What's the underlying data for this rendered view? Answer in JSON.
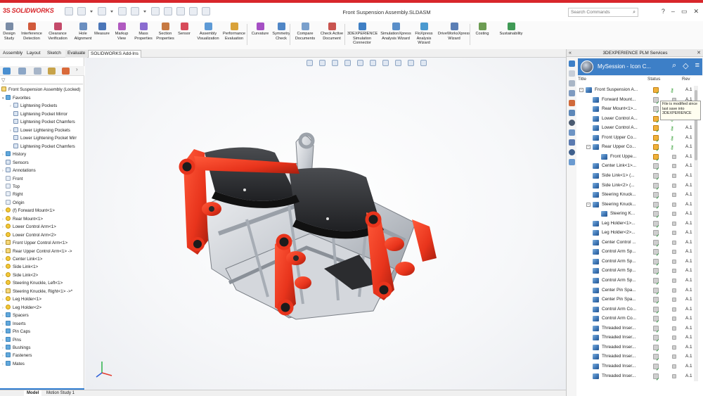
{
  "app": {
    "logo_text": "SOLIDWORKS",
    "logo_prefix": "3S",
    "document_title": "Front Suspension Assembly.SLDASM",
    "search_placeholder": "Search Commands",
    "accent_color": "#d8262b"
  },
  "ribbon": {
    "buttons": [
      {
        "label": "Design\nStudy",
        "icon": "design-study-icon",
        "color": "#7a8ca6"
      },
      {
        "label": "Interference\nDetection",
        "icon": "interference-icon",
        "color": "#d15a3c"
      },
      {
        "label": "Clearance\nVerification",
        "icon": "clearance-icon",
        "color": "#c44a6a"
      },
      {
        "label": "Hole\nAlignment",
        "icon": "hole-icon",
        "color": "#6b8fc0"
      },
      {
        "label": "Measure",
        "icon": "measure-icon",
        "color": "#4b76b8"
      },
      {
        "label": "Markup\nView",
        "icon": "markup-icon",
        "color": "#b05ac0"
      },
      {
        "label": "Mass\nProperties",
        "icon": "mass-icon",
        "color": "#8b6cd0"
      },
      {
        "label": "Section\nProperties",
        "icon": "section-icon",
        "color": "#c77a42"
      },
      {
        "label": "Sensor",
        "icon": "sensor-icon",
        "color": "#d74b5a"
      },
      {
        "label": "Assembly\nVisualization",
        "icon": "assembly-vis-icon",
        "color": "#5d9ad6"
      },
      {
        "label": "Performance\nEvaluation",
        "icon": "performance-icon",
        "color": "#d9a23a"
      },
      {
        "label": "Curvature",
        "icon": "curvature-icon",
        "color": "#a54fc4"
      },
      {
        "label": "Symmetry\nCheck",
        "icon": "symmetry-icon",
        "color": "#4f86c6"
      },
      {
        "label": "Compare\nDocuments",
        "icon": "compare-icon",
        "color": "#7aa0cc"
      },
      {
        "label": "Check Active\nDocument",
        "icon": "check-doc-icon",
        "color": "#c9544f"
      },
      {
        "label": "3DEXPERIENCE\nSimulation\nConnector",
        "icon": "sim-connector-icon",
        "color": "#3f7fc4"
      },
      {
        "label": "SimulationXpress\nAnalysis Wizard",
        "icon": "simxpress-icon",
        "color": "#5a8fc9"
      },
      {
        "label": "FloXpress\nAnalysis\nWizard",
        "icon": "floxpress-icon",
        "color": "#4b9ad0"
      },
      {
        "label": "DriveWorksXpress\nWizard",
        "icon": "driveworks-icon",
        "color": "#5b7fb5"
      },
      {
        "label": "Costing",
        "icon": "costing-icon",
        "color": "#6c9c52"
      },
      {
        "label": "Sustainability",
        "icon": "sustainability-icon",
        "color": "#3f9a55"
      }
    ]
  },
  "tabs": {
    "items": [
      "Assembly",
      "Layout",
      "Sketch",
      "Evaluate",
      "SOLIDWORKS Add-Ins"
    ],
    "active": "Evaluate"
  },
  "tree": {
    "root": "Front Suspension Assembly  (Locked)",
    "items": [
      {
        "label": "Favorites",
        "icon": "folder",
        "indent": 1,
        "toggle": "▾"
      },
      {
        "label": "Lightening Pockets",
        "icon": "feat",
        "indent": 2,
        "toggle": "›"
      },
      {
        "label": "Lightening Pocket Mirror",
        "icon": "feat",
        "indent": 2,
        "toggle": ""
      },
      {
        "label": "Lightening Pocket Chamfers",
        "icon": "feat",
        "indent": 2,
        "toggle": ""
      },
      {
        "label": "Lower Lightening Pockets",
        "icon": "feat",
        "indent": 2,
        "toggle": "›"
      },
      {
        "label": "Lower Lightening Pocket Mirr",
        "icon": "feat",
        "indent": 2,
        "toggle": ""
      },
      {
        "label": "Lightening Pocket Chamfers",
        "icon": "feat",
        "indent": 2,
        "toggle": ""
      },
      {
        "label": "History",
        "icon": "folder",
        "indent": 1,
        "toggle": "›"
      },
      {
        "label": "Sensors",
        "icon": "feat",
        "indent": 1,
        "toggle": ""
      },
      {
        "label": "Annotations",
        "icon": "feat",
        "indent": 1,
        "toggle": "›"
      },
      {
        "label": "Front",
        "icon": "plane",
        "indent": 1,
        "toggle": ""
      },
      {
        "label": "Top",
        "icon": "plane",
        "indent": 1,
        "toggle": ""
      },
      {
        "label": "Right",
        "icon": "plane",
        "indent": 1,
        "toggle": ""
      },
      {
        "label": "Origin",
        "icon": "plane",
        "indent": 1,
        "toggle": ""
      },
      {
        "label": "(f) Forward Mount<1>",
        "icon": "yellow",
        "indent": 1,
        "toggle": "›"
      },
      {
        "label": "Rear Mount<1>",
        "icon": "yellow",
        "indent": 1,
        "toggle": "›"
      },
      {
        "label": "Lower Control Arm<1>",
        "icon": "yellow",
        "indent": 1,
        "toggle": "›"
      },
      {
        "label": "Lower Control Arm<2>",
        "icon": "yellow",
        "indent": 1,
        "toggle": "›"
      },
      {
        "label": "Front Upper Control Arm<1>",
        "icon": "asm",
        "indent": 1,
        "toggle": "›"
      },
      {
        "label": "Rear Upper Control Arm<1> ->",
        "icon": "asm",
        "indent": 1,
        "toggle": "›"
      },
      {
        "label": "Center Link<1>",
        "icon": "yellow",
        "indent": 1,
        "toggle": "›"
      },
      {
        "label": "Side Link<1>",
        "icon": "yellow",
        "indent": 1,
        "toggle": "›"
      },
      {
        "label": "Side Link<2>",
        "icon": "yellow",
        "indent": 1,
        "toggle": "›"
      },
      {
        "label": "Steering Knuckle, Left<1>",
        "icon": "yellow",
        "indent": 1,
        "toggle": "›"
      },
      {
        "label": "Steering Knuckle, Right<1> ->*",
        "icon": "asm",
        "indent": 1,
        "toggle": "›"
      },
      {
        "label": "Leg Holder<1>",
        "icon": "yellow",
        "indent": 1,
        "toggle": "›"
      },
      {
        "label": "Leg Holder<2>",
        "icon": "yellow",
        "indent": 1,
        "toggle": "›"
      },
      {
        "label": "Spacers",
        "icon": "folder",
        "indent": 1,
        "toggle": "›"
      },
      {
        "label": "Inserts",
        "icon": "folder",
        "indent": 1,
        "toggle": "›"
      },
      {
        "label": "Pin Caps",
        "icon": "folder",
        "indent": 1,
        "toggle": "›"
      },
      {
        "label": "Pins",
        "icon": "folder",
        "indent": 1,
        "toggle": "›"
      },
      {
        "label": "Bushings",
        "icon": "folder",
        "indent": 1,
        "toggle": "›"
      },
      {
        "label": "Fasteners",
        "icon": "folder",
        "indent": 1,
        "toggle": "›"
      },
      {
        "label": "Mates",
        "icon": "folder",
        "indent": 1,
        "toggle": "›"
      }
    ]
  },
  "bottom_tabs": {
    "items": [
      "Model",
      "Motion Study 1"
    ],
    "active": "Model"
  },
  "plm": {
    "panel_title": "3DEXPERIENCE PLM Services",
    "session": "MySession - Icon C...",
    "col_title": "Title",
    "col_status": "Status",
    "col_rev": "Rev",
    "tooltip": "File is modified since last save into 3DEXPERIENCE",
    "rows": [
      {
        "title": "Front Suspension A...",
        "level": 0,
        "expand": "−",
        "status": "orange",
        "key": true,
        "rev": "A.1"
      },
      {
        "title": "Forward Mount...",
        "level": 1,
        "expand": "",
        "status": "gray",
        "key": false,
        "rev": "A.1"
      },
      {
        "title": "Rear Mount<1>...",
        "level": 1,
        "expand": "",
        "status": "gray",
        "key": false,
        "rev": "A.1"
      },
      {
        "title": "Lower Control A...",
        "level": 1,
        "expand": "",
        "status": "orange",
        "key": true,
        "rev": "A.1"
      },
      {
        "title": "Lower Control A...",
        "level": 1,
        "expand": "",
        "status": "orange",
        "key": true,
        "rev": "A.1"
      },
      {
        "title": "Front Upper Co...",
        "level": 1,
        "expand": "",
        "status": "orange",
        "key": true,
        "rev": "A.1"
      },
      {
        "title": "Rear Upper Co...",
        "level": 1,
        "expand": "−",
        "status": "orange",
        "key": true,
        "rev": "A.1"
      },
      {
        "title": "Front Uppe...",
        "level": 2,
        "expand": "",
        "status": "orange",
        "key": false,
        "rev": "A.1"
      },
      {
        "title": "Center Link<1>...",
        "level": 1,
        "expand": "",
        "status": "gray",
        "key": false,
        "rev": "A.1"
      },
      {
        "title": "Side Link<1> (...",
        "level": 1,
        "expand": "",
        "status": "gray",
        "key": false,
        "rev": "A.1"
      },
      {
        "title": "Side Link<2> (...",
        "level": 1,
        "expand": "",
        "status": "gray",
        "key": false,
        "rev": "A.1"
      },
      {
        "title": "Steering Knuck...",
        "level": 1,
        "expand": "",
        "status": "gray",
        "key": false,
        "rev": "A.1"
      },
      {
        "title": "Steering Knuck...",
        "level": 1,
        "expand": "−",
        "status": "gray",
        "key": false,
        "rev": "A.1"
      },
      {
        "title": "Steering K...",
        "level": 2,
        "expand": "",
        "status": "gray",
        "key": false,
        "rev": "A.1"
      },
      {
        "title": "Leg Holder<1>...",
        "level": 1,
        "expand": "",
        "status": "gray",
        "key": false,
        "rev": "A.1"
      },
      {
        "title": "Leg Holder<2>...",
        "level": 1,
        "expand": "",
        "status": "gray",
        "key": false,
        "rev": "A.1"
      },
      {
        "title": "Center Control ...",
        "level": 1,
        "expand": "",
        "status": "gray",
        "key": false,
        "rev": "A.1"
      },
      {
        "title": "Control Arm Sp...",
        "level": 1,
        "expand": "",
        "status": "gray",
        "key": false,
        "rev": "A.1"
      },
      {
        "title": "Control Arm Sp...",
        "level": 1,
        "expand": "",
        "status": "gray",
        "key": false,
        "rev": "A.1"
      },
      {
        "title": "Control Arm Sp...",
        "level": 1,
        "expand": "",
        "status": "gray",
        "key": false,
        "rev": "A.1"
      },
      {
        "title": "Control Arm Sp...",
        "level": 1,
        "expand": "",
        "status": "gray",
        "key": false,
        "rev": "A.1"
      },
      {
        "title": "Center Pin Spa...",
        "level": 1,
        "expand": "",
        "status": "gray",
        "key": false,
        "rev": "A.1"
      },
      {
        "title": "Center Pin Spa...",
        "level": 1,
        "expand": "",
        "status": "gray",
        "key": false,
        "rev": "A.1"
      },
      {
        "title": "Control Arm Co...",
        "level": 1,
        "expand": "",
        "status": "gray",
        "key": false,
        "rev": "A.1"
      },
      {
        "title": "Control Arm Co...",
        "level": 1,
        "expand": "",
        "status": "gray",
        "key": false,
        "rev": "A.1"
      },
      {
        "title": "Threaded Inser...",
        "level": 1,
        "expand": "",
        "status": "gray",
        "key": false,
        "rev": "A.1"
      },
      {
        "title": "Threaded Inser...",
        "level": 1,
        "expand": "",
        "status": "gray",
        "key": false,
        "rev": "A.1"
      },
      {
        "title": "Threaded Inser...",
        "level": 1,
        "expand": "",
        "status": "gray",
        "key": false,
        "rev": "A.1"
      },
      {
        "title": "Threaded Inser...",
        "level": 1,
        "expand": "",
        "status": "gray",
        "key": false,
        "rev": "A.1"
      },
      {
        "title": "Threaded Inser...",
        "level": 1,
        "expand": "",
        "status": "gray",
        "key": false,
        "rev": "A.1"
      },
      {
        "title": "Threaded Inser...",
        "level": 1,
        "expand": "",
        "status": "gray",
        "key": false,
        "rev": "A.1"
      }
    ]
  }
}
